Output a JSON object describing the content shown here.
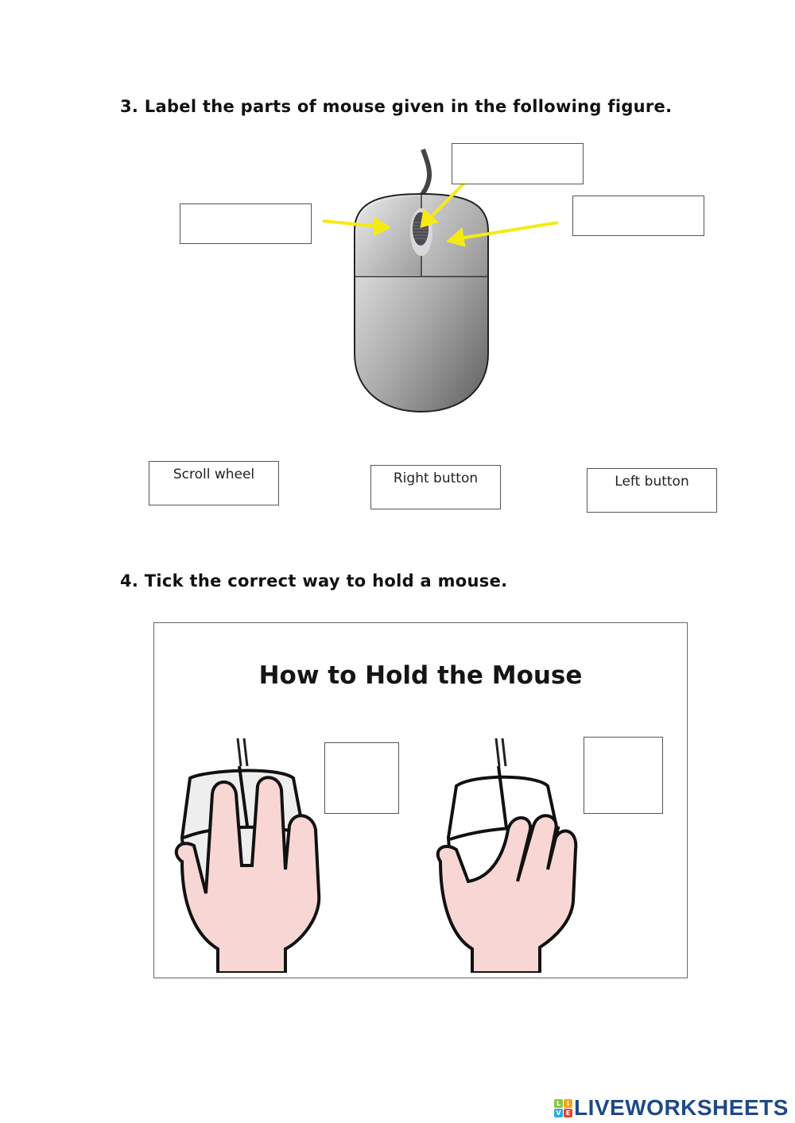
{
  "question3": {
    "title": "3. Label the parts of mouse given in the following figure.",
    "answer_slots": [
      {
        "id": "left-button-slot",
        "value": ""
      },
      {
        "id": "scroll-wheel-slot",
        "value": ""
      },
      {
        "id": "right-button-slot",
        "value": ""
      }
    ],
    "word_bank": [
      "Scroll wheel",
      "Right button",
      "Left button"
    ],
    "arrow_color": "#f5ea14"
  },
  "question4": {
    "title": "4. Tick the correct way to hold a mouse.",
    "image_title": "How to Hold the Mouse",
    "tick_boxes": [
      {
        "id": "grip-fingers-on-buttons",
        "checked": false
      },
      {
        "id": "grip-hand-over-mouse",
        "checked": false
      }
    ]
  },
  "footer": {
    "brand": "LIVEWORKSHEETS",
    "logo_letters": [
      "L",
      "I",
      "V",
      "E"
    ],
    "brand_color": "#1d4a87"
  }
}
